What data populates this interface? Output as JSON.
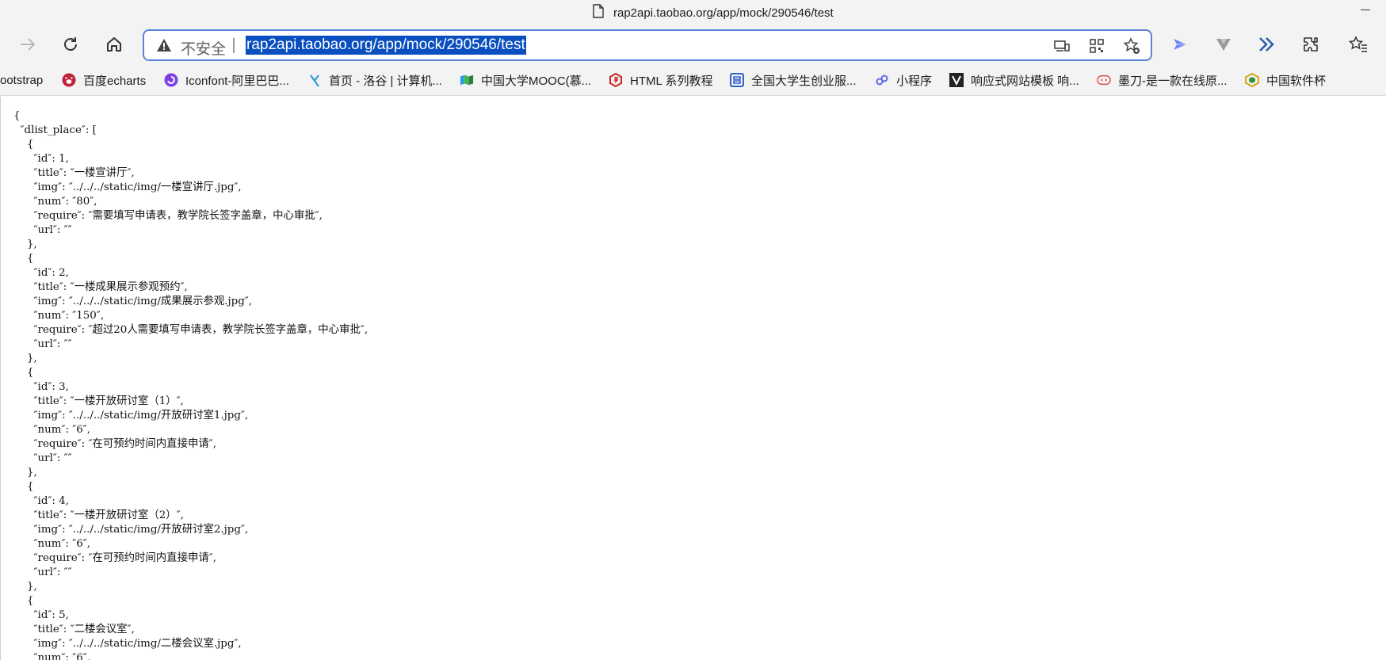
{
  "window": {
    "title": "rap2api.taobao.org/app/mock/290546/test"
  },
  "toolbar": {
    "security_label": "不安全",
    "url": "rap2api.taobao.org/app/mock/290546/test",
    "icons": [
      "forward-icon",
      "refresh-icon",
      "home-icon",
      "warning-icon",
      "device-icon",
      "qr-icon",
      "add-favorite-icon",
      "extension-blue-icon",
      "extension-v-icon",
      "extension-arrows-icon",
      "extensions-icon",
      "favorites-icon"
    ]
  },
  "bookmarks": [
    {
      "label": "ootstrap",
      "icon": "none"
    },
    {
      "label": "百度echarts",
      "icon": "baidu-icon"
    },
    {
      "label": "Iconfont-阿里巴巴...",
      "icon": "iconfont-icon"
    },
    {
      "label": "首页 - 洛谷 | 计算机...",
      "icon": "luogu-icon"
    },
    {
      "label": "中国大学MOOC(慕...",
      "icon": "mooc-icon"
    },
    {
      "label": "HTML 系列教程",
      "icon": "html-icon"
    },
    {
      "label": "全国大学生创业服...",
      "icon": "startup-icon"
    },
    {
      "label": "小程序",
      "icon": "miniprogram-icon"
    },
    {
      "label": "响应式网站模板 响...",
      "icon": "template-icon"
    },
    {
      "label": "墨刀-是一款在线原...",
      "icon": "modao-icon"
    },
    {
      "label": "中国软件杯",
      "icon": "cnsoftbei-icon"
    }
  ],
  "colors": {
    "chrome": "#f3f3f3",
    "address_border": "#5b84d6",
    "selection": "#0a4fbf",
    "text": "#111111"
  },
  "json_text": "{\n  ″dlist_place″: [\n    {\n      ″id″: 1,\n      ″title″: ″一楼宣讲厅″,\n      ″img″: ″../../../static/img/一楼宣讲厅.jpg″,\n      ″num″: ″80″,\n      ″require″: ″需要填写申请表，教学院长签字盖章，中心审批″,\n      ″url″: ″″\n    },\n    {\n      ″id″: 2,\n      ″title″: ″一楼成果展示参观预约″,\n      ″img″: ″../../../static/img/成果展示参观.jpg″,\n      ″num″: ″150″,\n      ″require″: ″超过20人需要填写申请表，教学院长签字盖章，中心审批″,\n      ″url″: ″″\n    },\n    {\n      ″id″: 3,\n      ″title″: ″一楼开放研讨室（1）″,\n      ″img″: ″../../../static/img/开放研讨室1.jpg″,\n      ″num″: ″6″,\n      ″require″: ″在可预约时间内直接申请″,\n      ″url″: ″″\n    },\n    {\n      ″id″: 4,\n      ″title″: ″一楼开放研讨室（2）″,\n      ″img″: ″../../../static/img/开放研讨室2.jpg″,\n      ″num″: ″6″,\n      ″require″: ″在可预约时间内直接申请″,\n      ″url″: ″″\n    },\n    {\n      ″id″: 5,\n      ″title″: ″二楼会议室″,\n      ″img″: ″../../../static/img/二楼会议室.jpg″,\n      ″num″: ″6″,"
}
